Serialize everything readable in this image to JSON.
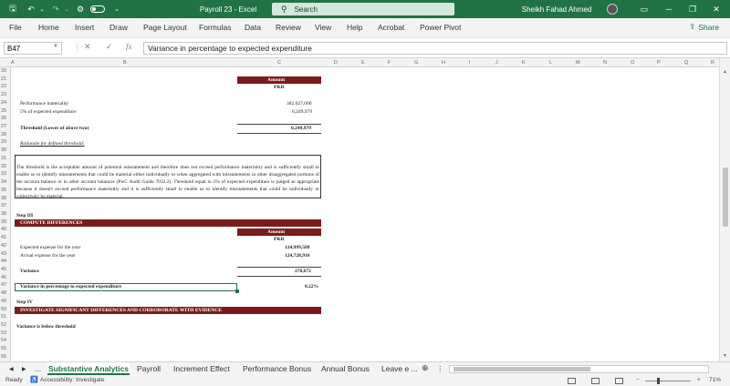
{
  "titlebar": {
    "title": "Payroll 23  -  Excel",
    "search_placeholder": "Search",
    "user": "Sheikh Fahad Ahmed",
    "icons": [
      "save-icon",
      "undo-icon",
      "redo-icon",
      "customize-icon",
      "autosave-toggle",
      "ribbon-display-icon",
      "minimize-icon",
      "restore-icon",
      "close-icon"
    ]
  },
  "ribbon": {
    "tabs": [
      "File",
      "Home",
      "Insert",
      "Draw",
      "Page Layout",
      "Formulas",
      "Data",
      "Review",
      "View",
      "Help",
      "Acrobat",
      "Power Pivot"
    ],
    "share": "Share"
  },
  "formula_bar": {
    "name_box": "B47",
    "fx": "fx",
    "content": "Variance in percentage to expected expenditure"
  },
  "columns": [
    "A",
    "B",
    "C",
    "D",
    "E",
    "F",
    "G",
    "H",
    "I",
    "J",
    "K",
    "L",
    "M",
    "N",
    "O",
    "P",
    "Q",
    "R"
  ],
  "rows": [
    "20",
    "21",
    "22",
    "23",
    "24",
    "25",
    "26",
    "27",
    "28",
    "29",
    "30",
    "31",
    "32",
    "33",
    "34",
    "35",
    "36",
    "37",
    "38",
    "39",
    "40",
    "41",
    "42",
    "43",
    "44",
    "45",
    "46",
    "47",
    "48",
    "49",
    "50",
    "51",
    "52",
    "53",
    "54",
    "55",
    "56"
  ],
  "sheet": {
    "amount_header_1": "Amount",
    "pkr_1": "PKR",
    "perf_materiality_label": "Performance materiality",
    "perf_materiality_value": "382,627,000",
    "pct_expected_label": "5% of expected expenditure",
    "pct_expected_value": "6,249,979",
    "threshold_label": "Threshold (Lower of above two)",
    "threshold_value": "6,249,979",
    "rationale_label": "Rationale for defined threshold:",
    "rationale_text": "The threshold is the acceptable amount of potential misstatement and therefore does not exceed performance materiality and is sufficiently small to enable us to identify misstatements that could be material either individually or when aggregated with misstatements in other disaggregated portions of the account balance or in other account balances (PwC Audit Guide 7033.2). Threshold equal to 5% of expected expenditure is judged as appropriate because it doesn't exceed performance materiality and it is sufficiently small to enable us to identify misstatements that could be individually or collectively be material.",
    "step3": "Step III",
    "compute_header": "COMPUTE DIFFERENCES",
    "amount_header_2": "Amount",
    "pkr_2": "PKR",
    "expected_label": "Expected expense for the year",
    "expected_value": "124,999,588",
    "actual_label": "Actual expense for the year",
    "actual_value": "124,728,916",
    "variance_label": "Variance",
    "variance_value": "270,672",
    "variance_pct_label": "Variance in percentage to expected expenditure",
    "variance_pct_value": "0.22%",
    "step4": "Step IV",
    "investigate_header": "INVESTIGATE SIGNIFICANT DIFFERENCES AND CORROBORATE WITH EVIDENCE",
    "conclusion": "Variance is below threshold"
  },
  "sheet_tabs": {
    "ellipsis": "...",
    "tabs": [
      "Substantive Analytics",
      "Payroll",
      "Increment Effect",
      "Performance Bonus",
      "Annual Bonus",
      "Leave e ..."
    ],
    "active": "Substantive Analytics"
  },
  "status": {
    "ready": "Ready",
    "accessibility": "Accessibility: Investigate",
    "zoom": "71%"
  },
  "colors": {
    "excel_green": "#217346",
    "band_maroon": "#7b1c1c"
  }
}
